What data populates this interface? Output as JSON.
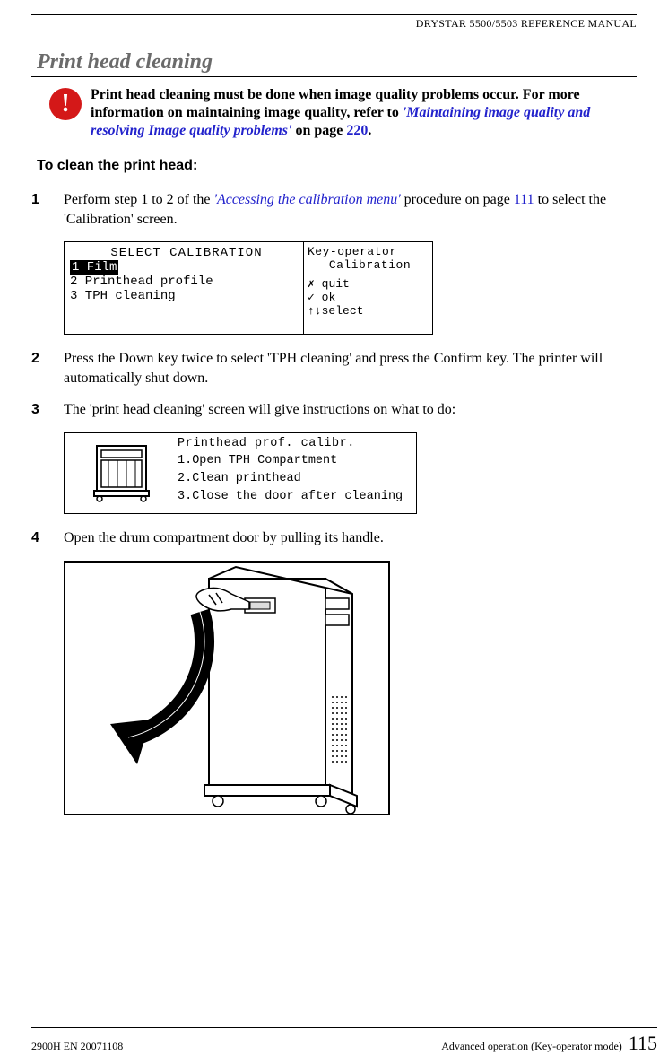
{
  "header": {
    "title": "DRYSTAR 5500/5503 REFERENCE MANUAL"
  },
  "section_title": "Print head cleaning",
  "warning": {
    "pre": "Print head cleaning must be done when image quality problems occur. For more information on maintaining image quality, refer to ",
    "link": "'Maintaining image quality and resolving Image quality problems'",
    "mid": " on page ",
    "page": "220",
    "post": "."
  },
  "subhead": "To clean the print head:",
  "steps": [
    {
      "num": "1",
      "pre": "Perform step 1 to 2 of the ",
      "link": "'Accessing the calibration menu'",
      "mid": " procedure on page ",
      "page": "111",
      "post": " to select the 'Calibration' screen."
    },
    {
      "num": "2",
      "text": "Press the Down key twice to select 'TPH cleaning' and press the Confirm key. The printer will automatically shut down."
    },
    {
      "num": "3",
      "text": "The 'print head cleaning' screen will give instructions on what to do:"
    },
    {
      "num": "4",
      "text": "Open the drum compartment door by pulling its handle."
    }
  ],
  "lcd1": {
    "title": "SELECT CALIBRATION",
    "items": [
      "1 Film",
      "2 Printhead profile",
      "3 TPH cleaning"
    ],
    "right_header1": "Key-operator",
    "right_header2": "Calibration",
    "actions": [
      "quit",
      "ok",
      "select"
    ]
  },
  "lcd2": {
    "title": "Printhead prof. calibr.",
    "lines": [
      "1.Open TPH Compartment",
      "2.Clean printhead",
      "3.Close the door after cleaning"
    ]
  },
  "footer": {
    "left": "2900H EN 20071108",
    "right": "Advanced operation (Key-operator mode)",
    "page": "115"
  }
}
